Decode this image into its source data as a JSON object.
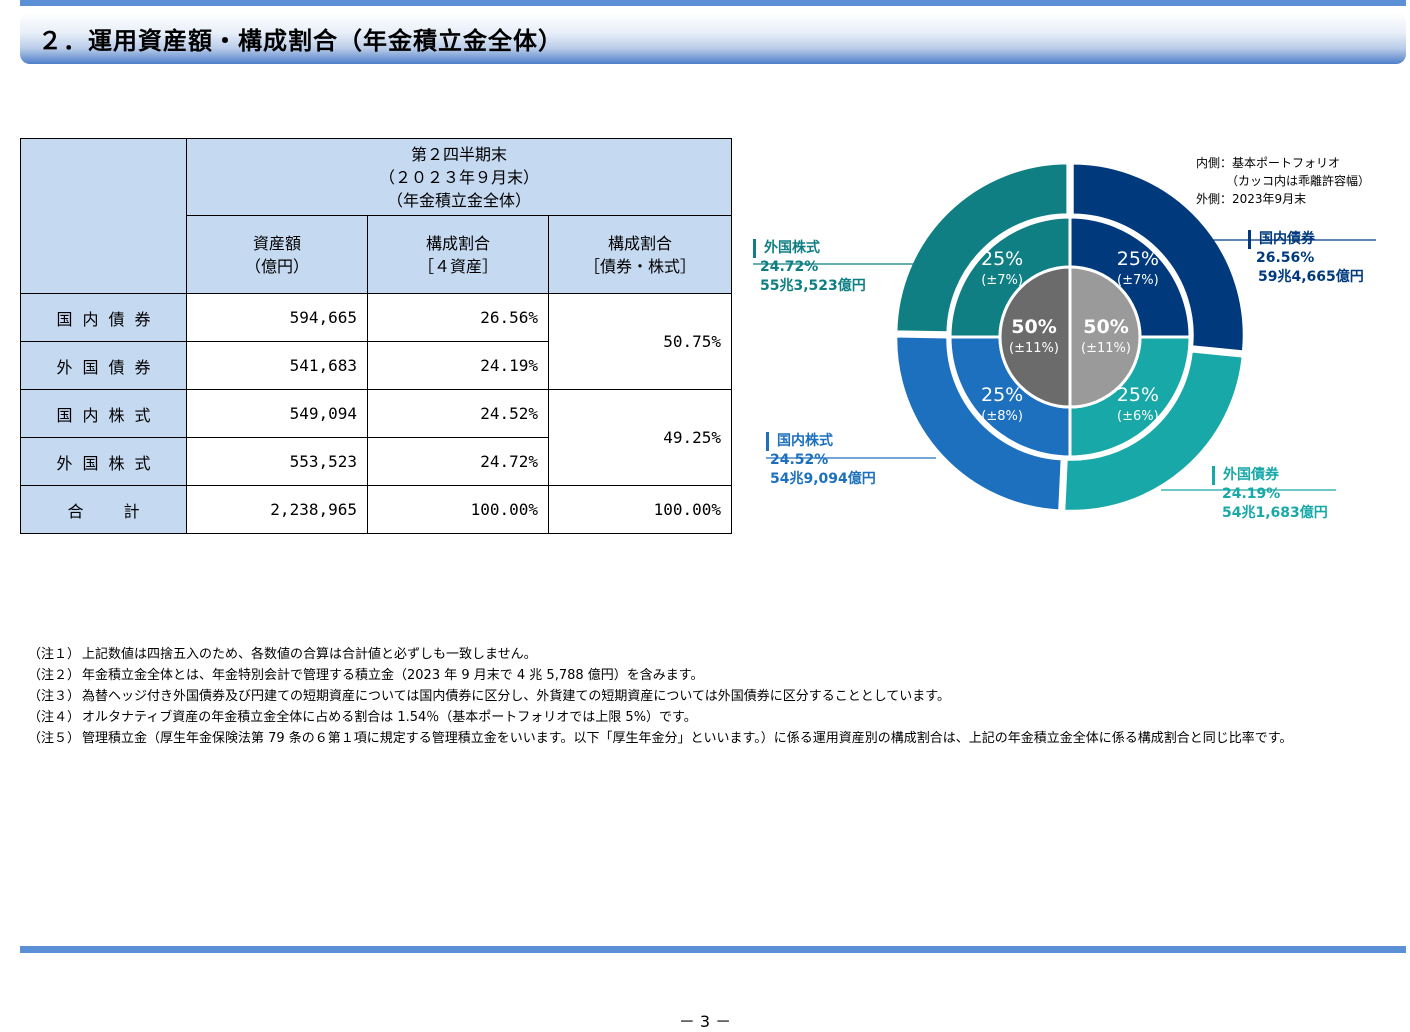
{
  "header": {
    "title": "２．運用資産額・構成割合（年金積立金全体）"
  },
  "table": {
    "period": [
      "第２四半期末",
      "（２０２３年９月末）",
      "（年金積立金全体）"
    ],
    "columns": [
      [
        "資産額",
        "（億円）"
      ],
      [
        "構成割合",
        "［４資産］"
      ],
      [
        "構成割合",
        "［債券・株式］"
      ]
    ],
    "rows": [
      {
        "label": "国内債券",
        "amount": "594,665",
        "share": "26.56%"
      },
      {
        "label": "外国債券",
        "amount": "541,683",
        "share": "24.19%"
      },
      {
        "label": "国内株式",
        "amount": "549,094",
        "share": "24.52%"
      },
      {
        "label": "外国株式",
        "amount": "553,523",
        "share": "24.72%"
      }
    ],
    "groups": {
      "bonds": "50.75%",
      "stocks": "49.25%"
    },
    "total": {
      "label": "合計",
      "amount": "2,238,965",
      "share": "100.00%",
      "share2": "100.00%"
    }
  },
  "chart_data": {
    "type": "pie",
    "legend_note": [
      "内側：基本ポートフォリオ",
      "（カッコ内は乖離許容幅）",
      "外側：2023年9月末"
    ],
    "outer": [
      {
        "name": "国内債券",
        "percent": 26.56,
        "label": "26.56%",
        "amount": "59兆4,665億円",
        "color": "#003a7d"
      },
      {
        "name": "外国債券",
        "percent": 24.19,
        "label": "24.19%",
        "amount": "54兆1,683億円",
        "color": "#18a8a8"
      },
      {
        "name": "国内株式",
        "percent": 24.52,
        "label": "24.52%",
        "amount": "54兆9,094億円",
        "color": "#1d70bd"
      },
      {
        "name": "外国株式",
        "percent": 24.72,
        "label": "24.72%",
        "amount": "55兆3,523億円",
        "color": "#0f7f83"
      }
    ],
    "middle": [
      {
        "percent": 25,
        "label": "25%",
        "range": "(±7%)",
        "color": "#003a7d"
      },
      {
        "percent": 25,
        "label": "25%",
        "range": "(±6%)",
        "color": "#18a8a8"
      },
      {
        "percent": 25,
        "label": "25%",
        "range": "(±8%)",
        "color": "#1d70bd"
      },
      {
        "percent": 25,
        "label": "25%",
        "range": "(±7%)",
        "color": "#0f7f83"
      }
    ],
    "inner": [
      {
        "percent": 50,
        "label": "50%",
        "range": "(±11%)",
        "color": "#9a9a9a"
      },
      {
        "percent": 50,
        "label": "50%",
        "range": "(±11%)",
        "color": "#6b6b6b"
      }
    ]
  },
  "notes": [
    {
      "label": "（注１）",
      "text": "上記数値は四捨五入のため、各数値の合算は合計値と必ずしも一致しません。"
    },
    {
      "label": "（注２）",
      "text": "年金積立金全体とは、年金特別会計で管理する積立金（2023 年 9 月末で 4 兆 5,788 億円）を含みます。"
    },
    {
      "label": "（注３）",
      "text": "為替ヘッジ付き外国債券及び円建ての短期資産については国内債券に区分し、外貨建ての短期資産については外国債券に区分することとしています。"
    },
    {
      "label": "（注４）",
      "text": "オルタナティブ資産の年金積立金全体に占める割合は 1.54％（基本ポートフォリオでは上限 5%）です。"
    },
    {
      "label": "（注５）",
      "text": "管理積立金（厚生年金保険法第 79 条の６第１項に規定する管理積立金をいいます。以下「厚生年金分」といいます。）に係る運用資産別の構成割合は、上記の年金積立金全体に係る構成割合と同じ比率です。"
    }
  ],
  "footer": {
    "page": "－ 3 －"
  }
}
